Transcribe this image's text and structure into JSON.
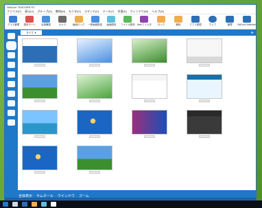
{
  "window": {
    "title": "SkiDoor TEACHER PC"
  },
  "menu": {
    "items": [
      "ファイル(F)",
      "表示(V)",
      "グループ(G)",
      "教材(M)",
      "モニタ(O)",
      "コマンド(C)",
      "ツール(T)",
      "学習(S)",
      "ウィンドウ(W)",
      "ヘルプ(H)"
    ]
  },
  "toolbar": {
    "items": [
      {
        "label": "クラス管理",
        "color": "#3b7fd4"
      },
      {
        "label": "端末モード",
        "color": "#d9534f"
      },
      {
        "label": "出席確認",
        "color": "#4a90e2"
      },
      {
        "label": "カメラ",
        "color": "#6b6b6b"
      },
      {
        "label": "画面ロック",
        "color": "#f0ad4e"
      },
      {
        "label": "一斉画面配信",
        "color": "#4a90e2"
      },
      {
        "label": "画面配信",
        "color": "#5bc0de"
      },
      {
        "label": "ファイル配布",
        "color": "#5cb85c"
      },
      {
        "label": "Webフィルタ",
        "color": "#8e44ad"
      }
    ],
    "right": [
      {
        "label": "ロック",
        "color": "#f0ad4e"
      },
      {
        "label": "解除",
        "color": "#f0ad4e"
      },
      {
        "label": "アプリ制限",
        "color": "#2c6fb7"
      },
      {
        "label": "ウェブ",
        "color": "#2c6fb7"
      },
      {
        "label": "管理",
        "color": "#2c6fb7"
      },
      {
        "label": "SkiDoor Assistant",
        "color": "#2c6fb7"
      }
    ]
  },
  "tabs": [
    {
      "label": "すべて ▾"
    }
  ],
  "status": {
    "left": "全体表示",
    "items": [
      "サムネール",
      "ウインドウ",
      "ズーム"
    ]
  },
  "thumbnails": [
    {
      "theme": "windows-blue"
    },
    {
      "theme": "web-blue"
    },
    {
      "theme": "vista-green"
    },
    {
      "theme": "explorer"
    },
    {
      "theme": "xp-bliss"
    },
    {
      "theme": "vista-green"
    },
    {
      "theme": "browser"
    },
    {
      "theme": "app-teal"
    },
    {
      "theme": "beach"
    },
    {
      "theme": "win7"
    },
    {
      "theme": "metro"
    },
    {
      "theme": "dark-app"
    },
    {
      "theme": "win7"
    },
    {
      "theme": "xp-bliss"
    }
  ]
}
